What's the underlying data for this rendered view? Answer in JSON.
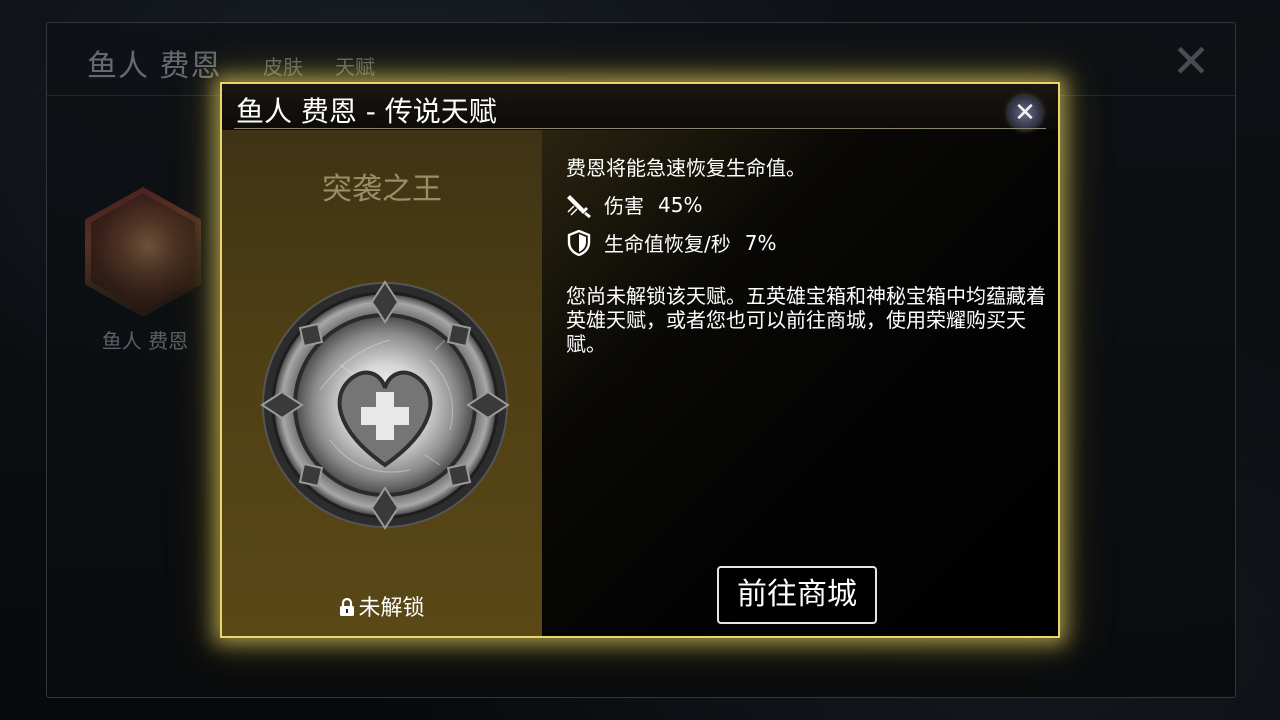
{
  "background": {
    "hero_window": {
      "title": "鱼人 费恩",
      "tabs": [
        "皮肤",
        "天赋"
      ],
      "close_label": "✕",
      "portrait_name": "鱼人 费恩"
    }
  },
  "dialog": {
    "title": "鱼人 费恩 - 传说天赋",
    "close_label": "✕",
    "talent": {
      "name": "突袭之王",
      "emblem_icon": "heart-plus-icon",
      "status": "未解锁"
    },
    "description": "费恩将能急速恢复生命值。",
    "stats": [
      {
        "icon": "sword-icon",
        "label": "伤害",
        "value": "45%"
      },
      {
        "icon": "shield-icon",
        "label": "生命值恢复/秒",
        "value": "7%"
      }
    ],
    "unlock_info": "您尚未解锁该天赋。五英雄宝箱和神秘宝箱中均蕴藏着英雄天赋，或者您也可以前往商城，使用荣耀购买天赋。",
    "shop_button": "前往商城"
  },
  "colors": {
    "dialog_border": "#e9d56a",
    "left_panel": "#4f3f14",
    "talent_name": "#9c8d66"
  }
}
